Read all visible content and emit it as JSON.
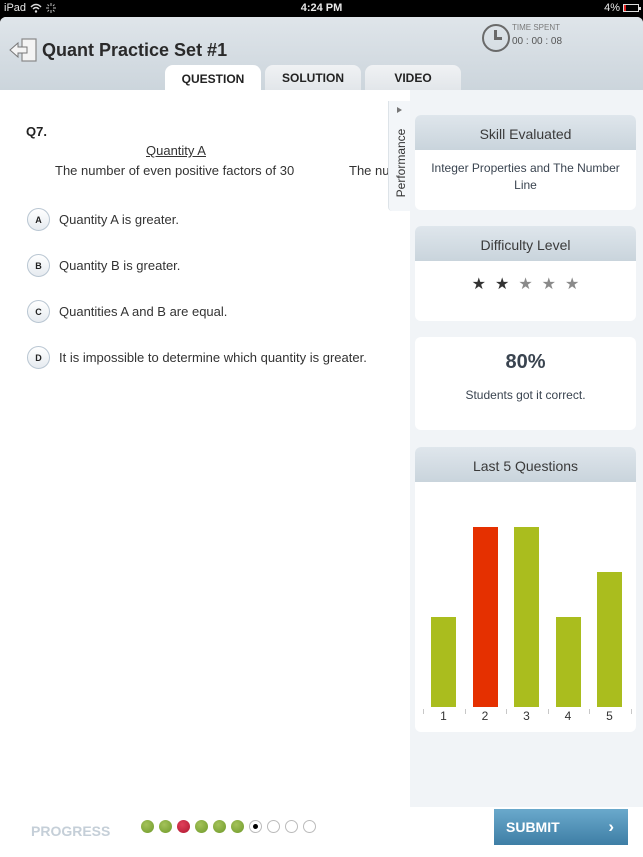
{
  "status_bar": {
    "device": "iPad",
    "time": "4:24 PM",
    "battery": "4%",
    "battery_level": 0.04
  },
  "header": {
    "title": "Quant Practice Set #1",
    "timer_label": "TIME SPENT",
    "timer_value": "00 : 00 : 08",
    "tabs": [
      {
        "label": "QUESTION",
        "active": true
      },
      {
        "label": "SOLUTION",
        "active": false
      },
      {
        "label": "VIDEO",
        "active": false
      }
    ]
  },
  "question": {
    "number": "Q7.",
    "quantity_a_heading": "Quantity A",
    "quantity_a_text": "The number of even positive factors of 30",
    "quantity_b_text_visible": "The nu",
    "options": [
      {
        "letter": "A",
        "text": "Quantity A is greater."
      },
      {
        "letter": "B",
        "text": "Quantity B is greater."
      },
      {
        "letter": "C",
        "text": "Quantities A and B are equal."
      },
      {
        "letter": "D",
        "text": "It is impossible to determine which quantity is greater."
      }
    ]
  },
  "performance": {
    "tab_label": "Performance",
    "skill_heading": "Skill Evaluated",
    "skill_value": "Integer Properties and The Number Line",
    "difficulty_heading": "Difficulty Level",
    "difficulty_stars": 2,
    "difficulty_max": 5,
    "star_glyph": "★",
    "percent_correct": "80%",
    "percent_label": "Students got it correct.",
    "last5_heading": "Last 5 Questions",
    "colors": {
      "correct": "#aabd1e",
      "wrong": "#e53000",
      "star_on": "#333333",
      "star_off": "#8a8a8a"
    }
  },
  "chart_data": {
    "type": "bar",
    "title": "Last 5 Questions",
    "categories": [
      "1",
      "2",
      "3",
      "4",
      "5"
    ],
    "values": [
      2,
      4,
      4,
      2,
      3
    ],
    "status": [
      "correct",
      "wrong",
      "correct",
      "correct",
      "correct"
    ],
    "ylim": [
      0,
      4
    ],
    "xlabel": "",
    "ylabel": "",
    "grid": false
  },
  "footer": {
    "progress_label": "PROGRESS",
    "progress_dots": [
      "correct",
      "correct",
      "wrong",
      "correct",
      "correct",
      "correct",
      "current",
      "empty",
      "empty",
      "empty"
    ],
    "submit_label": "SUBMIT",
    "submit_chevron": "›"
  }
}
